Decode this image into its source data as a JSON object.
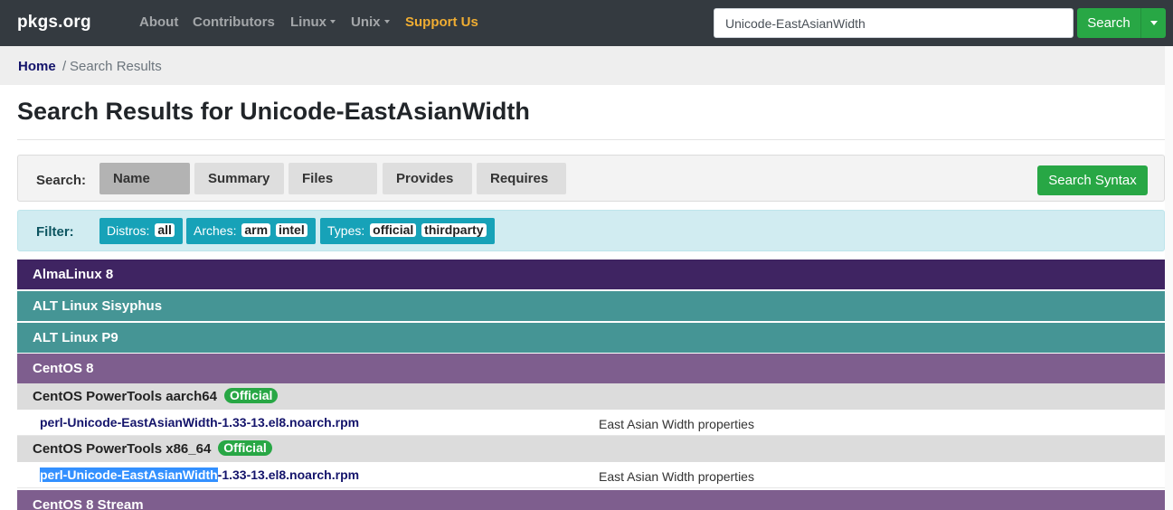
{
  "navbar": {
    "brand": "pkgs.org",
    "links": [
      {
        "label": "About"
      },
      {
        "label": "Contributors"
      },
      {
        "label": "Linux"
      },
      {
        "label": "Unix"
      },
      {
        "label": "Support Us"
      }
    ],
    "search_value": "Unicode-EastAsianWidth",
    "search_button": "Search"
  },
  "breadcrumb": {
    "home": "Home",
    "separator": "/",
    "current": "Search Results"
  },
  "page_title": "Search Results for Unicode-EastAsianWidth",
  "search_bar": {
    "label": "Search:",
    "tabs": [
      "Name",
      "Summary",
      "Files",
      "Provides",
      "Requires"
    ],
    "active_tab": "Name",
    "syntax_button": "Search Syntax"
  },
  "filter_bar": {
    "label": "Filter:",
    "distros_label": "Distros:",
    "distros": [
      "all"
    ],
    "arches_label": "Arches:",
    "arches": [
      "arm",
      "intel"
    ],
    "types_label": "Types:",
    "types": [
      "official",
      "thirdparty"
    ]
  },
  "results": {
    "distros": [
      {
        "name": "AlmaLinux 8",
        "color": "#3f2462"
      },
      {
        "name": "ALT Linux Sisyphus",
        "color": "#459595"
      },
      {
        "name": "ALT Linux P9",
        "color": "#459595"
      },
      {
        "name": "CentOS 8",
        "color": "#7e5e8e"
      }
    ],
    "repos": [
      {
        "name": "CentOS PowerTools aarch64",
        "badge": "Official",
        "package": "perl-Unicode-EastAsianWidth-1.33-13.el8.noarch.rpm",
        "description": "East Asian Width properties"
      },
      {
        "name": "CentOS PowerTools x86_64",
        "badge": "Official",
        "package_selected": "perl-Unicode-EastAsianWidth",
        "package_rest": "-1.33-13.el8.noarch.rpm",
        "description": "East Asian Width properties"
      }
    ],
    "next_distro": {
      "name": "CentOS 8 Stream",
      "color": "#7e5e8e"
    }
  },
  "colors": {
    "navbar_bg": "#343a40",
    "accent_green": "#28a745",
    "link_navy": "#14146b",
    "filter_chip_bg": "#17a2b8",
    "support_link": "#f0ad32"
  }
}
